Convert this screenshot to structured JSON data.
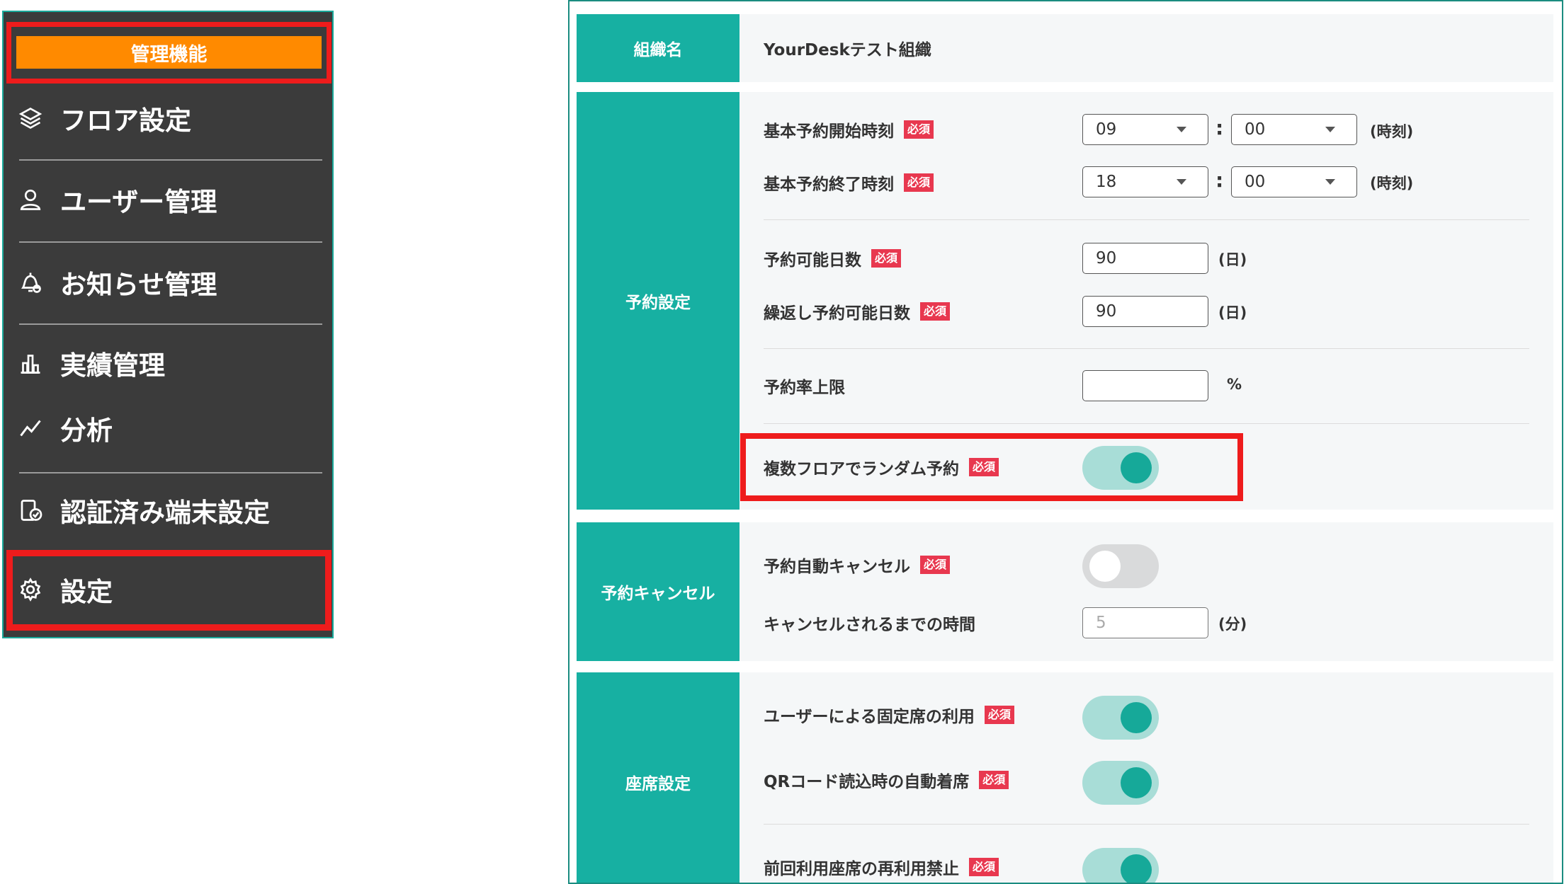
{
  "sidebar": {
    "header": "管理機能",
    "items": [
      {
        "label": "フロア設定",
        "icon": "layers-icon"
      },
      {
        "label": "ユーザー管理",
        "icon": "user-icon"
      },
      {
        "label": "お知らせ管理",
        "icon": "bell-icon"
      },
      {
        "label": "実績管理",
        "icon": "bar-chart-icon"
      },
      {
        "label": "分析",
        "icon": "line-chart-icon"
      },
      {
        "label": "認証済み端末設定",
        "icon": "device-check-icon"
      },
      {
        "label": "設定",
        "icon": "gear-icon"
      }
    ]
  },
  "required_badge": "必須",
  "org": {
    "head": "組織名",
    "value": "YourDeskテスト組織"
  },
  "reservation": {
    "head": "予約設定",
    "start_label": "基本予約開始時刻",
    "start_hour": "09",
    "start_min": "00",
    "end_label": "基本予約終了時刻",
    "end_hour": "18",
    "end_min": "00",
    "time_unit": "(時刻)",
    "colon": ":",
    "days_label": "予約可能日数",
    "days_value": "90",
    "repeat_label": "繰返し予約可能日数",
    "repeat_value": "90",
    "day_unit": "(日)",
    "rate_label": "予約率上限",
    "rate_value": "",
    "rate_unit": "%",
    "random_label": "複数フロアでランダム予約",
    "random_on": true
  },
  "cancel": {
    "head": "予約キャンセル",
    "auto_label": "予約自動キャンセル",
    "auto_on": false,
    "time_label": "キャンセルされるまでの時間",
    "time_value": "5",
    "time_unit": "(分)"
  },
  "seat": {
    "head": "座席設定",
    "fixed_label": "ユーザーによる固定席の利用",
    "fixed_on": true,
    "qr_label": "QRコード読込時の自動着席",
    "qr_on": true,
    "reuse_label": "前回利用座席の再利用禁止",
    "reuse_on": true
  },
  "colors": {
    "teal": "#17b0a2",
    "orange": "#ff8a00",
    "highlight_red": "#ee1c1c",
    "required_red": "#e8384f",
    "sidebar_bg": "#3b3b3b"
  }
}
